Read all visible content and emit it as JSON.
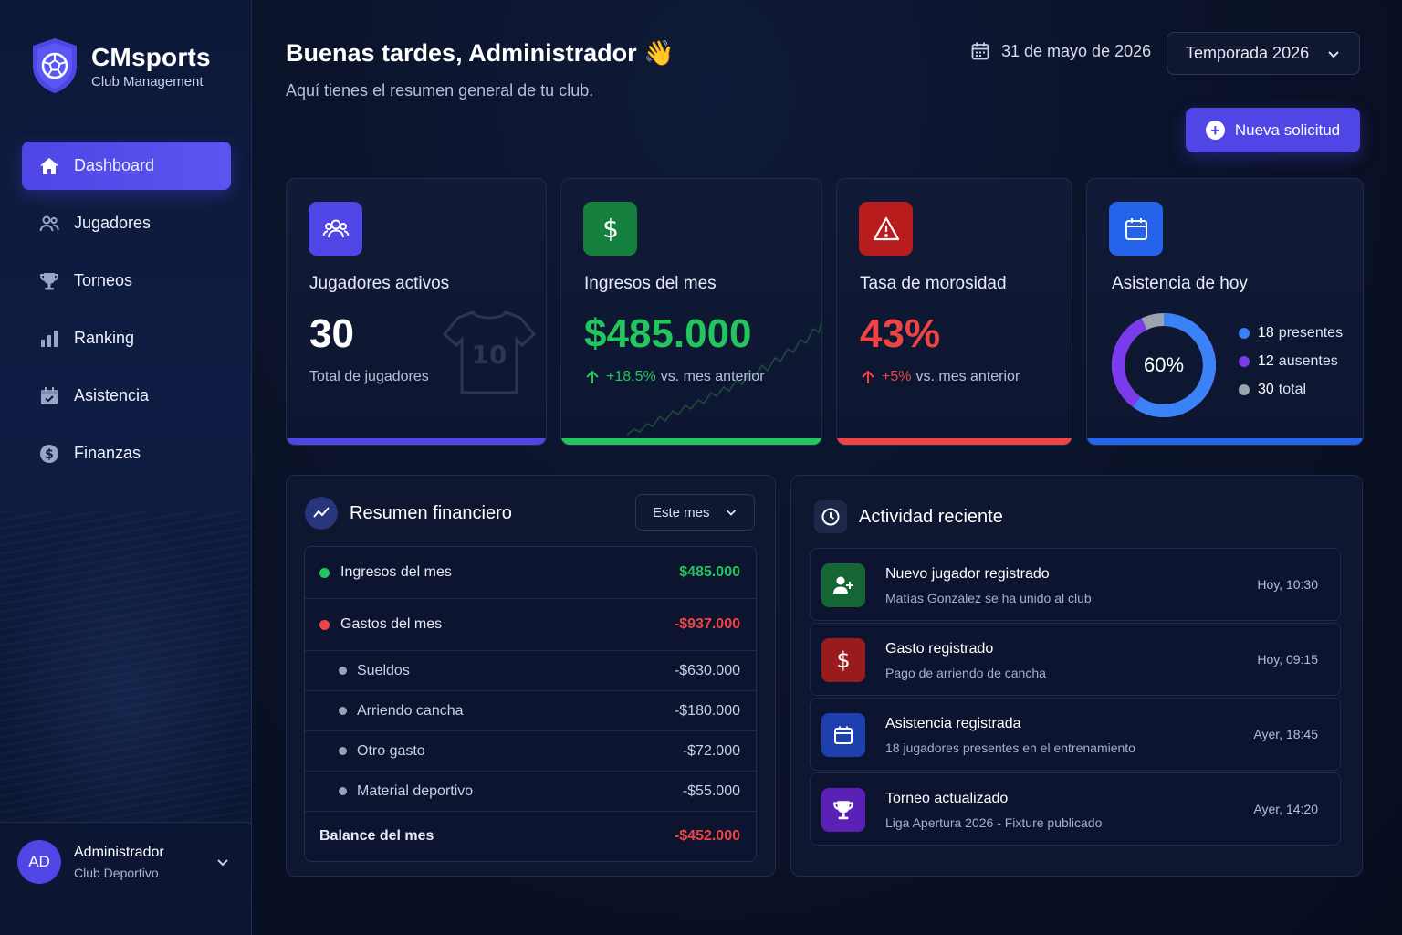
{
  "brand": {
    "name": "CMsports",
    "tagline": "Club Management"
  },
  "nav": [
    {
      "label": "Dashboard",
      "icon": "home-icon",
      "active": true
    },
    {
      "label": "Jugadores",
      "icon": "users-icon"
    },
    {
      "label": "Torneos",
      "icon": "trophy-icon"
    },
    {
      "label": "Ranking",
      "icon": "bar-chart-icon"
    },
    {
      "label": "Asistencia",
      "icon": "calendar-check-icon"
    },
    {
      "label": "Finanzas",
      "icon": "dollar-icon"
    }
  ],
  "user": {
    "initials": "AD",
    "name": "Administrador",
    "role": "Club Deportivo"
  },
  "header": {
    "greeting": "Buenas tardes, Administrador 👋",
    "subtitle": "Aquí tienes el resumen general de tu club.",
    "date": "31 de mayo de 2026",
    "season": "Temporada 2026",
    "new_request": "Nueva solicitud"
  },
  "stats": {
    "players": {
      "title": "Jugadores activos",
      "value": "30",
      "sub": "Total de jugadores",
      "shirt_number": "10"
    },
    "income": {
      "title": "Ingresos del mes",
      "value": "$485.000",
      "delta": "+18.5%",
      "sub": "vs. mes anterior"
    },
    "delinquency": {
      "title": "Tasa de morosidad",
      "value": "43%",
      "delta": "+5%",
      "sub": "vs. mes anterior"
    },
    "attendance": {
      "title": "Asistencia de hoy",
      "percent_label": "60%",
      "percent": 60,
      "present_count": "18",
      "present_label": "presentes",
      "absent_count": "12",
      "absent_label": "ausentes",
      "total_count": "30",
      "total_label": "total"
    }
  },
  "colors": {
    "accent": "#4f46e5",
    "green": "#22c55e",
    "red": "#ef4444",
    "blue": "#2563eb",
    "present": "#3b82f6",
    "absent": "#7c3aed",
    "total": "#9ca3af"
  },
  "finance": {
    "title": "Resumen financiero",
    "period": "Este mes",
    "income": {
      "label": "Ingresos del mes",
      "value": "$485.000"
    },
    "expenses": {
      "label": "Gastos del mes",
      "value": "-$937.000"
    },
    "items": [
      {
        "label": "Sueldos",
        "value": "-$630.000"
      },
      {
        "label": "Arriendo cancha",
        "value": "-$180.000"
      },
      {
        "label": "Otro gasto",
        "value": "-$72.000"
      },
      {
        "label": "Material deportivo",
        "value": "-$55.000"
      }
    ],
    "balance": {
      "label": "Balance del mes",
      "value": "-$452.000"
    }
  },
  "activity": {
    "title": "Actividad reciente",
    "items": [
      {
        "title": "Nuevo jugador registrado",
        "desc": "Matías González se ha unido al club",
        "time": "Hoy, 10:30",
        "icon": "user-plus-icon"
      },
      {
        "title": "Gasto registrado",
        "desc": "Pago de arriendo de cancha",
        "time": "Hoy, 09:15",
        "icon": "dollar-icon"
      },
      {
        "title": "Asistencia registrada",
        "desc": "18 jugadores presentes en el entrenamiento",
        "time": "Ayer, 18:45",
        "icon": "calendar-icon"
      },
      {
        "title": "Torneo actualizado",
        "desc": "Liga Apertura 2026 - Fixture publicado",
        "time": "Ayer, 14:20",
        "icon": "trophy-icon"
      }
    ]
  }
}
